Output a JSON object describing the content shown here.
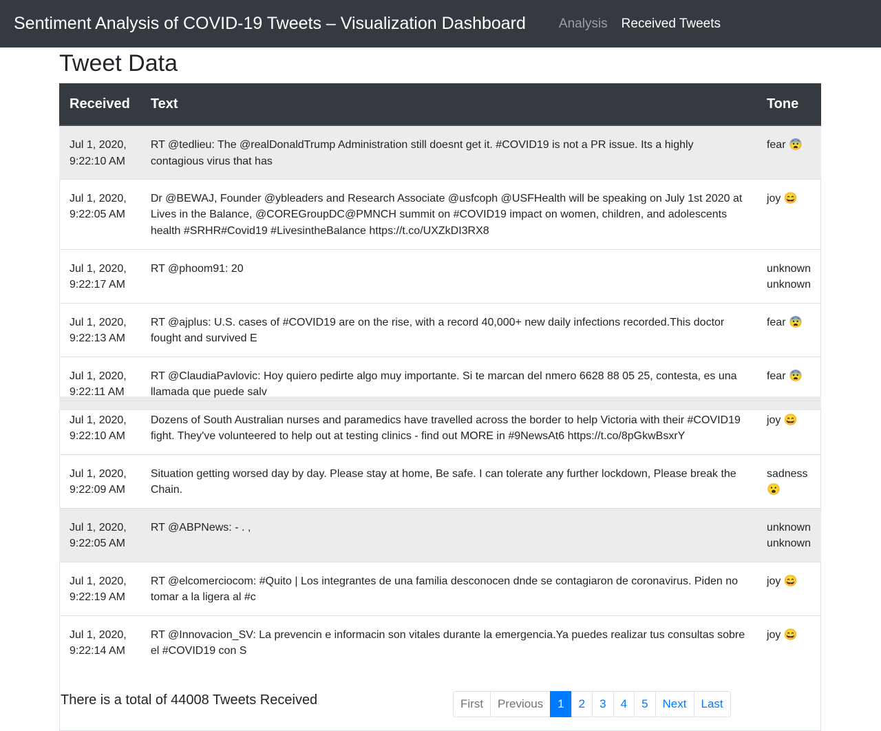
{
  "navbar": {
    "brand": "Sentiment Analysis of COVID-19 Tweets – Visualization Dashboard",
    "links": [
      "Analysis",
      "Received Tweets"
    ]
  },
  "page_title": "Tweet Data",
  "table": {
    "headers": [
      "Received",
      "Text",
      "Tone"
    ],
    "rows": [
      {
        "date": "Jul 1, 2020,",
        "time": "9:22:10 AM",
        "text": "RT @tedlieu: The @realDonaldTrump Administration still doesnt get it. #COVID19 is not a PR issue. Its a highly contagious virus that has",
        "tone": "fear",
        "emoji": "😨",
        "shaded": true
      },
      {
        "date": "Jul 1, 2020,",
        "time": "9:22:05 AM",
        "text": "Dr @BEWAJ, Founder @ybleaders and Research Associate @usfcoph @USFHealth will be speaking on July 1st 2020 at Lives in the Balance, @COREGroupDC@PMNCH summit on #COVID19 impact on women, children, and adolescents health #SRHR#Covid19 #LivesintheBalance https://t.co/UXZkDI3RX8",
        "tone": "joy",
        "emoji": "😄",
        "shaded": false
      },
      {
        "date": "Jul 1, 2020,",
        "time": "9:22:17 AM",
        "text": "RT @phoom91: 20",
        "tone": "unknown",
        "emoji": "unknown",
        "shaded": false
      },
      {
        "date": "Jul 1, 2020,",
        "time": "9:22:13 AM",
        "text": "RT @ajplus: U.S. cases of #COVID19 are on the rise, with a record 40,000+ new daily infections recorded.This doctor fought and survived E",
        "tone": "fear",
        "emoji": "😨",
        "shaded": false
      },
      {
        "date": "Jul 1, 2020,",
        "time": "9:22:11 AM",
        "text": "RT @ClaudiaPavlovic: Hoy quiero pedirte algo muy importante. Si te marcan del nmero 6628 88 05 25, contesta, es una llamada que puede salv",
        "tone": "fear",
        "emoji": "😨",
        "shaded": false
      },
      {
        "date": "Jul 1, 2020,",
        "time": "9:22:10 AM",
        "text": "Dozens of South Australian nurses and paramedics have travelled across the border to help Victoria with their #COVID19 fight. They've volunteered to help out at testing clinics - find out MORE in #9NewsAt6 https://t.co/8pGkwBsxrY",
        "tone": "joy",
        "emoji": "😄",
        "shaded": false
      },
      {
        "date": "Jul 1, 2020,",
        "time": "9:22:09 AM",
        "text": "Situation getting worsed day by day. Please stay at home, Be safe. I can tolerate any further lockdown, Please break the Chain.",
        "tone": "sadness",
        "emoji": "😮",
        "shaded": false
      },
      {
        "date": "Jul 1, 2020,",
        "time": "9:22:05 AM",
        "text": "RT @ABPNews: - . ,",
        "tone": "unknown",
        "emoji": "unknown",
        "shaded": true
      },
      {
        "date": "Jul 1, 2020,",
        "time": "9:22:19 AM",
        "text": "RT @elcomerciocom: #Quito | Los integrantes de una familia desconocen dnde se contagiaron de coronavirus. Piden no tomar a la ligera al #c",
        "tone": "joy",
        "emoji": "😄",
        "shaded": false
      },
      {
        "date": "Jul 1, 2020,",
        "time": "9:22:14 AM",
        "text": "RT @Innovacion_SV: La prevencin e informacin son vitales durante la emergencia.Ya puedes realizar tus consultas sobre el #COVID19 con S",
        "tone": "joy",
        "emoji": "😄",
        "shaded": false
      }
    ]
  },
  "footer": {
    "total_text": "There is a total of 44008 Tweets Received",
    "pagination": {
      "first": "First",
      "previous": "Previous",
      "pages": [
        "1",
        "2",
        "3",
        "4",
        "5"
      ],
      "active_page": "1",
      "next": "Next",
      "last": "Last"
    }
  },
  "colors": {
    "navbar_bg": "#343a40",
    "accent": "#007bff",
    "row_shade": "#ececec"
  }
}
